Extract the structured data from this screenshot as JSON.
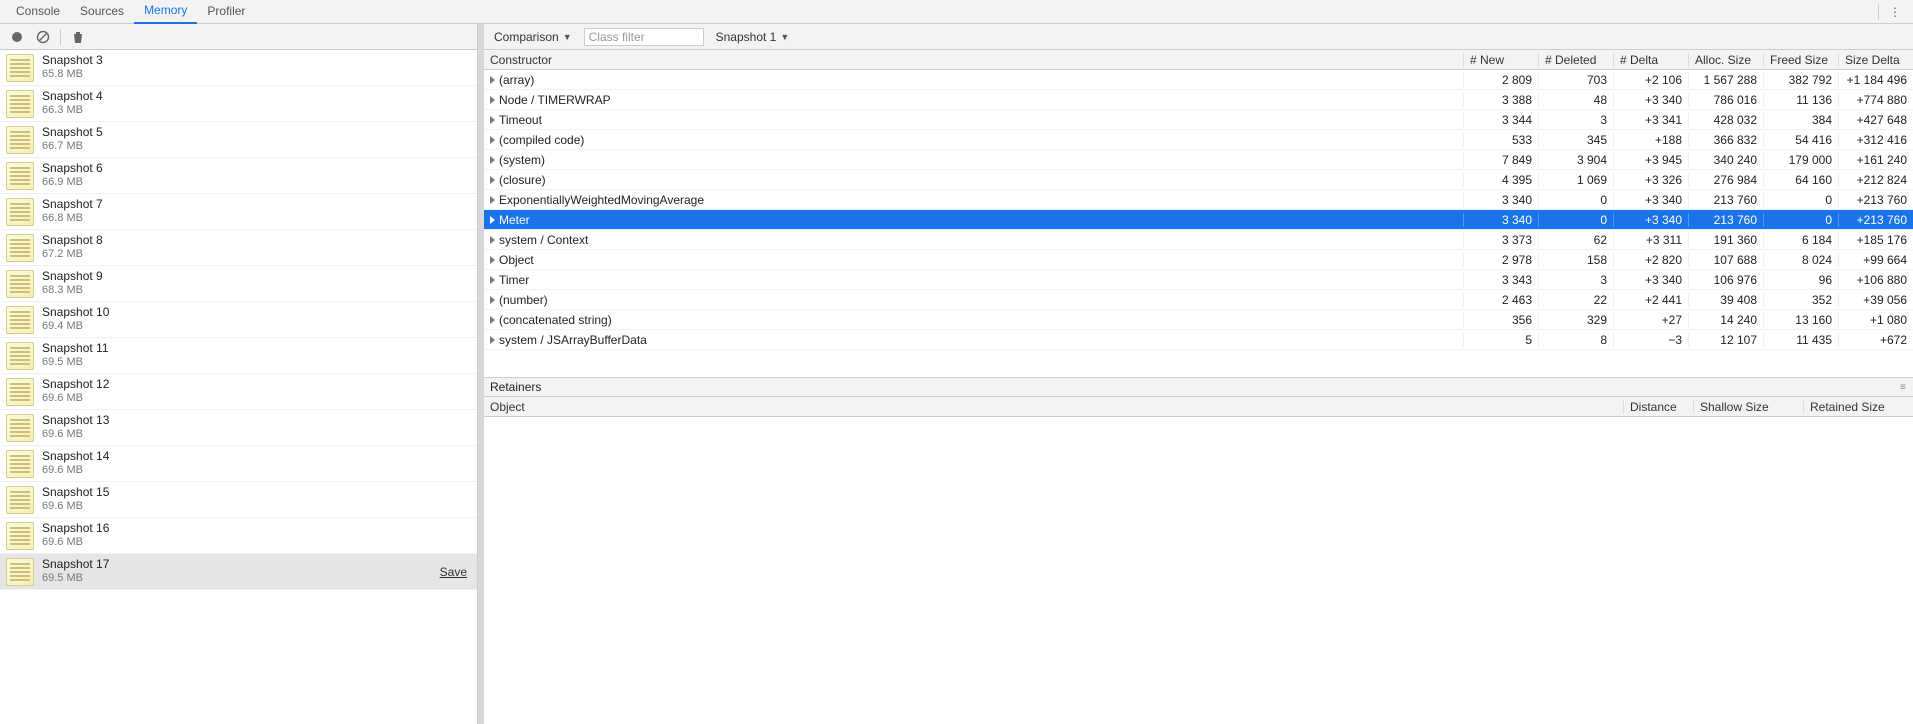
{
  "tabs": {
    "console": "Console",
    "sources": "Sources",
    "memory": "Memory",
    "profiler": "Profiler"
  },
  "sidebar": {
    "snapshots": [
      {
        "name": "Snapshot 3",
        "size": "65.8 MB"
      },
      {
        "name": "Snapshot 4",
        "size": "66.3 MB"
      },
      {
        "name": "Snapshot 5",
        "size": "66.7 MB"
      },
      {
        "name": "Snapshot 6",
        "size": "66.9 MB"
      },
      {
        "name": "Snapshot 7",
        "size": "66.8 MB"
      },
      {
        "name": "Snapshot 8",
        "size": "67.2 MB"
      },
      {
        "name": "Snapshot 9",
        "size": "68.3 MB"
      },
      {
        "name": "Snapshot 10",
        "size": "69.4 MB"
      },
      {
        "name": "Snapshot 11",
        "size": "69.5 MB"
      },
      {
        "name": "Snapshot 12",
        "size": "69.6 MB"
      },
      {
        "name": "Snapshot 13",
        "size": "69.6 MB"
      },
      {
        "name": "Snapshot 14",
        "size": "69.6 MB"
      },
      {
        "name": "Snapshot 15",
        "size": "69.6 MB"
      },
      {
        "name": "Snapshot 16",
        "size": "69.6 MB"
      },
      {
        "name": "Snapshot 17",
        "size": "69.5 MB",
        "selected": true,
        "save": "Save"
      }
    ]
  },
  "toolbar": {
    "view_mode": "Comparison",
    "filter_placeholder": "Class filter",
    "baseline": "Snapshot 1"
  },
  "columns": {
    "constructor": "Constructor",
    "new": "# New",
    "deleted": "# Deleted",
    "delta": "# Delta",
    "alloc_size": "Alloc. Size",
    "freed_size": "Freed Size",
    "size_delta": "Size Delta"
  },
  "rows": [
    {
      "c": "(array)",
      "new": "2 809",
      "del": "703",
      "delta": "+2 106",
      "alloc": "1 567 288",
      "freed": "382 792",
      "sdelta": "+1 184 496"
    },
    {
      "c": "Node / TIMERWRAP",
      "new": "3 388",
      "del": "48",
      "delta": "+3 340",
      "alloc": "786 016",
      "freed": "11 136",
      "sdelta": "+774 880"
    },
    {
      "c": "Timeout",
      "new": "3 344",
      "del": "3",
      "delta": "+3 341",
      "alloc": "428 032",
      "freed": "384",
      "sdelta": "+427 648"
    },
    {
      "c": "(compiled code)",
      "new": "533",
      "del": "345",
      "delta": "+188",
      "alloc": "366 832",
      "freed": "54 416",
      "sdelta": "+312 416"
    },
    {
      "c": "(system)",
      "new": "7 849",
      "del": "3 904",
      "delta": "+3 945",
      "alloc": "340 240",
      "freed": "179 000",
      "sdelta": "+161 240"
    },
    {
      "c": "(closure)",
      "new": "4 395",
      "del": "1 069",
      "delta": "+3 326",
      "alloc": "276 984",
      "freed": "64 160",
      "sdelta": "+212 824"
    },
    {
      "c": "ExponentiallyWeightedMovingAverage",
      "new": "3 340",
      "del": "0",
      "delta": "+3 340",
      "alloc": "213 760",
      "freed": "0",
      "sdelta": "+213 760"
    },
    {
      "c": "Meter",
      "new": "3 340",
      "del": "0",
      "delta": "+3 340",
      "alloc": "213 760",
      "freed": "0",
      "sdelta": "+213 760",
      "selected": true
    },
    {
      "c": "system / Context",
      "new": "3 373",
      "del": "62",
      "delta": "+3 311",
      "alloc": "191 360",
      "freed": "6 184",
      "sdelta": "+185 176"
    },
    {
      "c": "Object",
      "new": "2 978",
      "del": "158",
      "delta": "+2 820",
      "alloc": "107 688",
      "freed": "8 024",
      "sdelta": "+99 664"
    },
    {
      "c": "Timer",
      "new": "3 343",
      "del": "3",
      "delta": "+3 340",
      "alloc": "106 976",
      "freed": "96",
      "sdelta": "+106 880"
    },
    {
      "c": "(number)",
      "new": "2 463",
      "del": "22",
      "delta": "+2 441",
      "alloc": "39 408",
      "freed": "352",
      "sdelta": "+39 056"
    },
    {
      "c": "(concatenated string)",
      "new": "356",
      "del": "329",
      "delta": "+27",
      "alloc": "14 240",
      "freed": "13 160",
      "sdelta": "+1 080"
    },
    {
      "c": "system / JSArrayBufferData",
      "new": "5",
      "del": "8",
      "delta": "−3",
      "alloc": "12 107",
      "freed": "11 435",
      "sdelta": "+672"
    }
  ],
  "retainers": {
    "title": "Retainers",
    "columns": {
      "object": "Object",
      "distance": "Distance",
      "shallow": "Shallow Size",
      "retained": "Retained Size"
    }
  }
}
